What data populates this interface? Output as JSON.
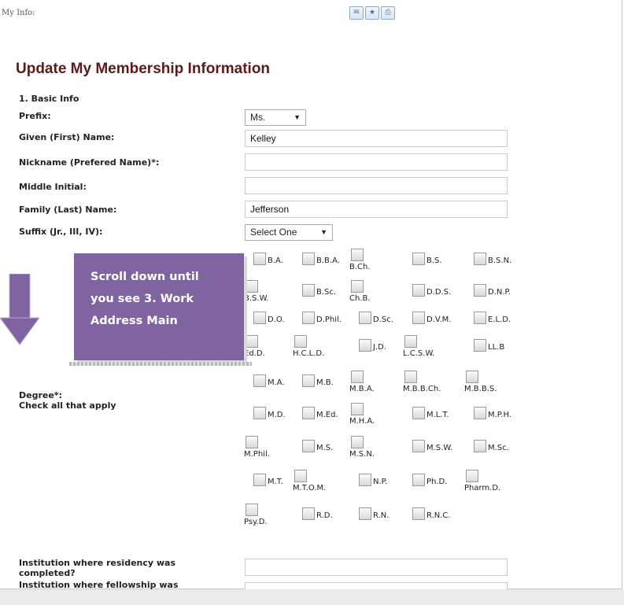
{
  "header": {
    "label": "My Info:",
    "icons": [
      "envelope-icon",
      "star-icon",
      "printer-icon"
    ]
  },
  "page": {
    "title": "Update My Membership Information",
    "section": "1. Basic Info"
  },
  "form": {
    "prefix": {
      "label": "Prefix:",
      "value": "Ms."
    },
    "given_name": {
      "label": "Given (First) Name:",
      "value": "Kelley"
    },
    "nickname": {
      "label": "Nickname (Prefered Name)*:",
      "value": ""
    },
    "middle_initial": {
      "label": "Middle Initial:",
      "value": ""
    },
    "family_name": {
      "label": "Family (Last) Name:",
      "value": "Jefferson"
    },
    "suffix": {
      "label": "Suffix (Jr., III, IV):",
      "value": "Select One"
    },
    "degree": {
      "label": "Degree*:",
      "sublabel": "Check all that apply"
    },
    "residency": {
      "label_line1": "Institution where residency was",
      "label_line2": "completed?",
      "value": ""
    },
    "fellowship": {
      "label": "Institution where fellowship was",
      "value": ""
    }
  },
  "degrees": [
    [
      "B.A.",
      "B.B.A.",
      "B.Ch.",
      "B.S.",
      "B.S.N."
    ],
    [
      "B.S.W.",
      "B.Sc.",
      "Ch.B.",
      "D.D.S.",
      "D.N.P."
    ],
    [
      "D.O.",
      "D.Phil.",
      "D.Sc.",
      "D.V.M.",
      "E.L.D."
    ],
    [
      "Ed.D.",
      "H.C.L.D.",
      "J.D.",
      "L.C.S.W.",
      "LL.B"
    ],
    [
      "M.A.",
      "M.B.",
      "M.B.A.",
      "M.B.B.Ch.",
      "M.B.B.S."
    ],
    [
      "M.D.",
      "M.Ed.",
      "M.H.A.",
      "M.L.T.",
      "M.P.H."
    ],
    [
      "M.Phil.",
      "M.S.",
      "M.S.N.",
      "M.S.W.",
      "M.Sc."
    ],
    [
      "M.T.",
      "M.T.O.M.",
      "N.P.",
      "Ph.D.",
      "Pharm.D."
    ],
    [
      "Psy.D.",
      "R.D.",
      "R.N.",
      "R.N.C."
    ]
  ],
  "degree_layout": [
    [
      "i",
      "i",
      "s",
      "i",
      "i"
    ],
    [
      "s",
      "i",
      "s",
      "i",
      "i"
    ],
    [
      "i",
      "i",
      "i",
      "i",
      "i"
    ],
    [
      "s",
      "s",
      "i",
      "s",
      "i"
    ],
    [
      "i",
      "i",
      "s",
      "s",
      "s"
    ],
    [
      "i",
      "i",
      "s",
      "i",
      "i"
    ],
    [
      "s",
      "i",
      "s",
      "i",
      "i"
    ],
    [
      "i",
      "s",
      "i",
      "i",
      "s"
    ],
    [
      "s",
      "i",
      "i",
      "i"
    ]
  ],
  "callout": {
    "text": "Scroll down until you see 3. Work Address Main"
  },
  "colors": {
    "title": "#5c1a1a",
    "callout_bg": "#8064a2",
    "arrow": "#8064a2"
  }
}
